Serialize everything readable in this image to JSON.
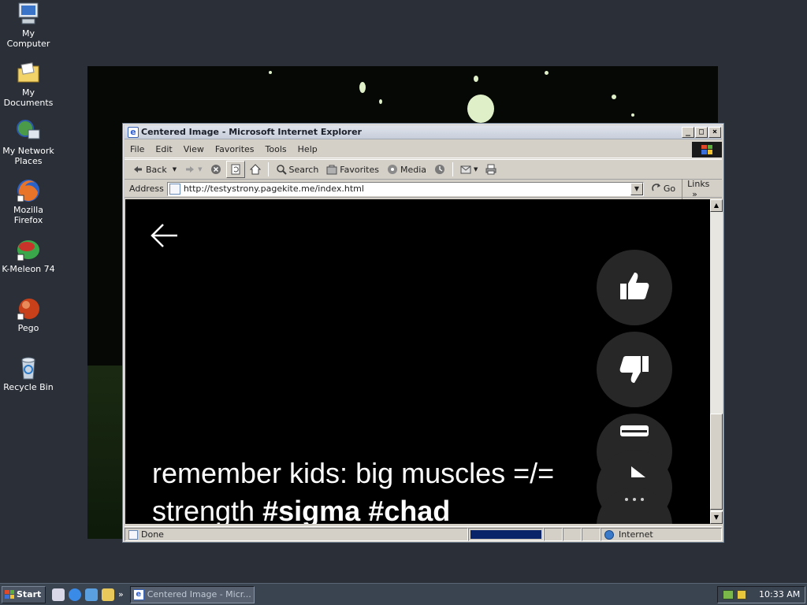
{
  "desktop": {
    "icons": [
      {
        "label": "My Computer"
      },
      {
        "label": "My Documents"
      },
      {
        "label": "My Network Places"
      },
      {
        "label": "Mozilla Firefox"
      },
      {
        "label": "K-Meleon 74"
      },
      {
        "label": "Pego"
      },
      {
        "label": "Recycle Bin"
      }
    ]
  },
  "window": {
    "title": "Centered Image - Microsoft Internet Explorer",
    "menu": [
      "File",
      "Edit",
      "View",
      "Favorites",
      "Tools",
      "Help"
    ],
    "toolbar": {
      "back": "Back",
      "search": "Search",
      "favorites": "Favorites",
      "media": "Media"
    },
    "address": {
      "label": "Address",
      "url": "http://testystrony.pagekite.me/index.html",
      "go": "Go",
      "links": "Links"
    },
    "content": {
      "caption_plain": "remember kids: big muscles =/= strength ",
      "caption_tag1": "#sigma",
      "caption_tag2": "#chad"
    },
    "status": {
      "text": "Done",
      "zone": "Internet"
    }
  },
  "taskbar": {
    "start": "Start",
    "task": "Centered Image - Micr...",
    "clock": "10:33 AM"
  }
}
